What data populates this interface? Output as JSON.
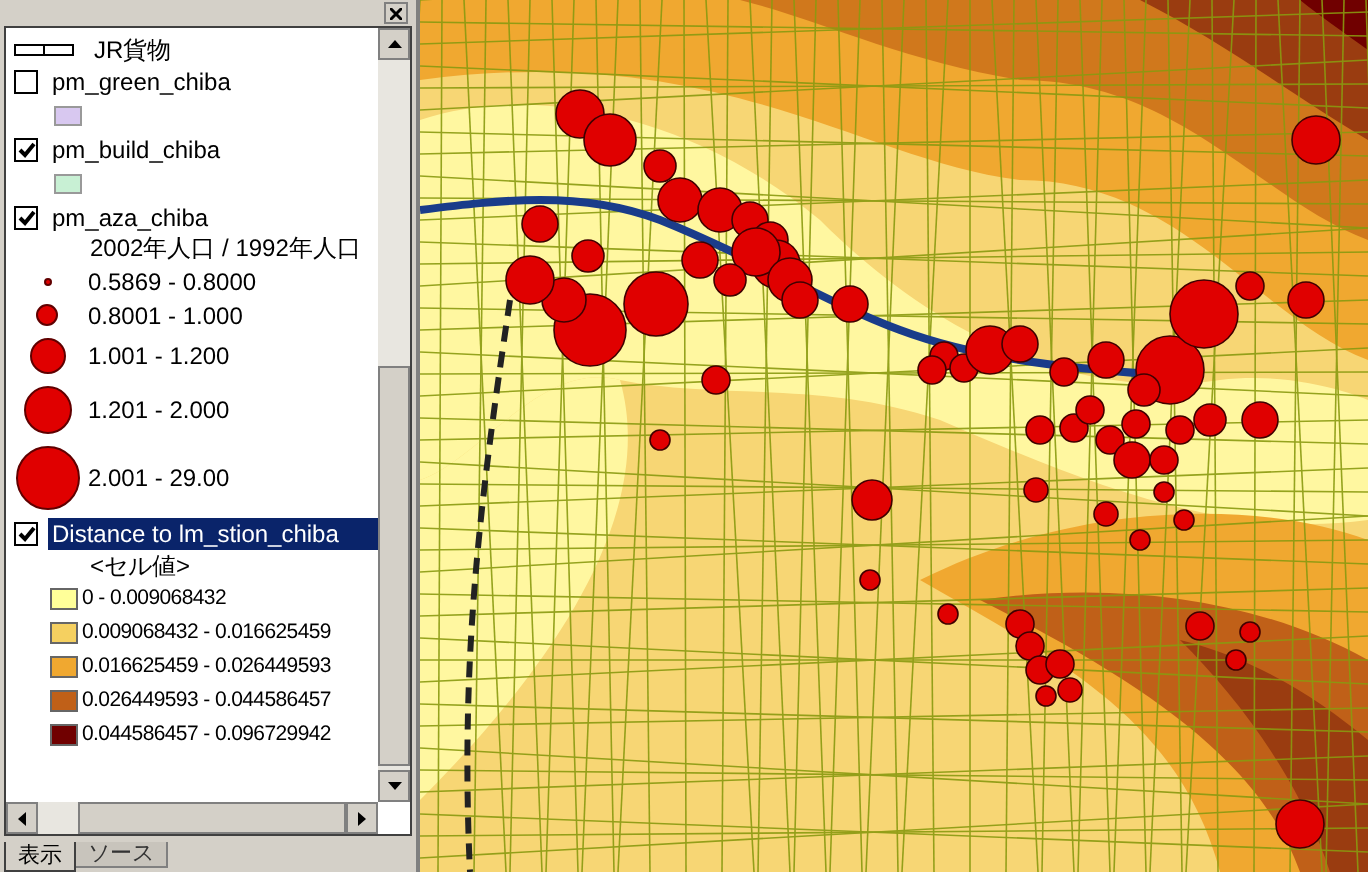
{
  "toc": {
    "layers": [
      {
        "kind": "line",
        "label": "JR貨物"
      },
      {
        "kind": "fill",
        "label": "pm_green_chiba",
        "checked": false,
        "selected": false,
        "color": "#d8c8f0"
      },
      {
        "kind": "fill",
        "label": "pm_build_chiba",
        "checked": true,
        "selected": false,
        "color": "#c8f0d4"
      },
      {
        "kind": "graduated",
        "label": "pm_aza_chiba",
        "checked": true,
        "selected": false,
        "heading": "2002年人口 / 1992年人口",
        "classes": [
          {
            "label": "0.5869 - 0.8000"
          },
          {
            "label": "0.8001 - 1.000"
          },
          {
            "label": "1.001 - 1.200"
          },
          {
            "label": "1.201 - 2.000"
          },
          {
            "label": "2.001 - 29.00"
          }
        ]
      },
      {
        "kind": "raster",
        "label": "Distance to lm_stion_chiba",
        "checked": true,
        "selected": true,
        "heading": "<セル値>",
        "classes": [
          {
            "label": "0 - 0.009068432",
            "color": "#ffff99"
          },
          {
            "label": "0.009068432 - 0.016625459",
            "color": "#f5d060"
          },
          {
            "label": "0.016625459 - 0.026449593",
            "color": "#f0a830"
          },
          {
            "label": "0.026449593 - 0.044586457",
            "color": "#c06018"
          },
          {
            "label": "0.044586457 - 0.096729942",
            "color": "#700000"
          }
        ]
      }
    ],
    "tabs": [
      {
        "label": "表示",
        "selected": true
      },
      {
        "label": "ソース",
        "selected": false
      }
    ]
  }
}
